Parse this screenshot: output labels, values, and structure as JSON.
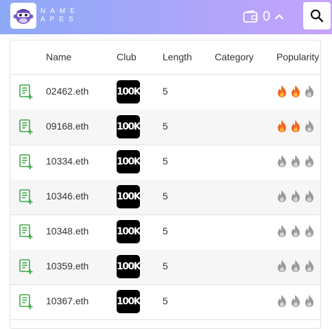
{
  "header": {
    "brand_line1": "NAME",
    "brand_line2": "APES",
    "wallet_count": "0",
    "colors": {
      "gradient_start": "#8da9f7",
      "gradient_end": "#c7a3fb"
    }
  },
  "table": {
    "columns": [
      "Name",
      "Club",
      "Length",
      "Category",
      "Popularity"
    ],
    "rows": [
      {
        "name": "02462.eth",
        "club": "100K",
        "length": "5",
        "category": "",
        "popularity": [
          true,
          true,
          false
        ]
      },
      {
        "name": "09168.eth",
        "club": "100K",
        "length": "5",
        "category": "",
        "popularity": [
          true,
          true,
          false
        ]
      },
      {
        "name": "10334.eth",
        "club": "100K",
        "length": "5",
        "category": "",
        "popularity": [
          false,
          false,
          false
        ]
      },
      {
        "name": "10346.eth",
        "club": "100K",
        "length": "5",
        "category": "",
        "popularity": [
          false,
          false,
          false
        ]
      },
      {
        "name": "10348.eth",
        "club": "100K",
        "length": "5",
        "category": "",
        "popularity": [
          false,
          false,
          false
        ]
      },
      {
        "name": "10359.eth",
        "club": "100K",
        "length": "5",
        "category": "",
        "popularity": [
          false,
          false,
          false
        ]
      },
      {
        "name": "10367.eth",
        "club": "100K",
        "length": "5",
        "category": "",
        "popularity": [
          false,
          false,
          false
        ]
      }
    ]
  },
  "icons": {
    "logo": "ape-logo-icon",
    "wallet": "wallet-icon",
    "chevron": "chevron-up-icon",
    "search": "search-icon",
    "add_to_list": "add-to-list-icon",
    "popularity": "fire-icon"
  },
  "status_colors": {
    "fire_active": "#f26522",
    "fire_inactive": "#9a9a9a",
    "add_icon": "#3ea84a"
  }
}
